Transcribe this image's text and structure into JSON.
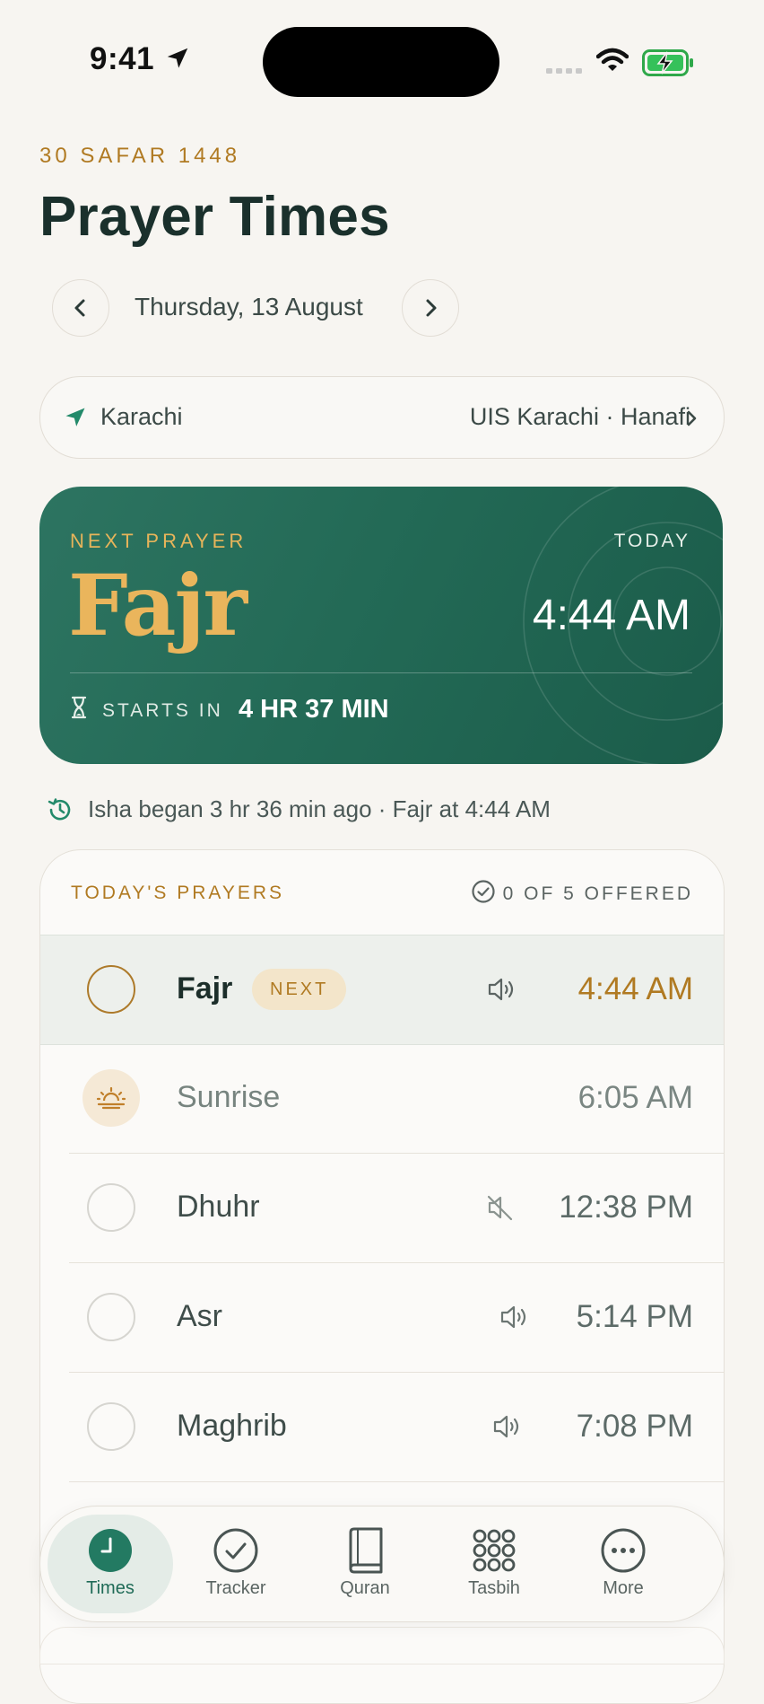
{
  "status_bar": {
    "time": "9:41"
  },
  "header": {
    "hijri_date": "30 SAFAR 1448",
    "title": "Prayer Times",
    "date": "Thursday, 13 August"
  },
  "location": {
    "city": "Karachi",
    "method": "UIS Karachi · Hanafi"
  },
  "next_prayer": {
    "label": "NEXT PRAYER",
    "day": "TODAY",
    "name": "Fajr",
    "time": "4:44 AM",
    "starts_in_label": "STARTS IN",
    "starts_in_value": "4 HR 37 MIN"
  },
  "info_line": "Isha began 3 hr 36 min ago · Fajr at 4:44 AM",
  "prayers": {
    "title": "TODAY'S PRAYERS",
    "offered": "0 OF 5 OFFERED",
    "next_badge": "NEXT",
    "items": [
      {
        "name": "Fajr",
        "time": "4:44 AM",
        "sound": "speaker-on",
        "status": "next"
      },
      {
        "name": "Sunrise",
        "time": "6:05 AM",
        "sound": "none",
        "status": "info"
      },
      {
        "name": "Dhuhr",
        "time": "12:38 PM",
        "sound": "speaker-muted",
        "status": "pending"
      },
      {
        "name": "Asr",
        "time": "5:14 PM",
        "sound": "speaker-on",
        "status": "pending"
      },
      {
        "name": "Maghrib",
        "time": "7:08 PM",
        "sound": "speaker-on",
        "status": "pending"
      }
    ]
  },
  "tabs": [
    {
      "label": "Times",
      "icon": "clock-icon",
      "active": true
    },
    {
      "label": "Tracker",
      "icon": "check-circle-icon",
      "active": false
    },
    {
      "label": "Quran",
      "icon": "book-icon",
      "active": false
    },
    {
      "label": "Tasbih",
      "icon": "beads-grid-icon",
      "active": false
    },
    {
      "label": "More",
      "icon": "more-icon",
      "active": false
    }
  ],
  "colors": {
    "accent_gold": "#b07a22",
    "card_green": "#236a56",
    "background": "#f7f5f1"
  }
}
